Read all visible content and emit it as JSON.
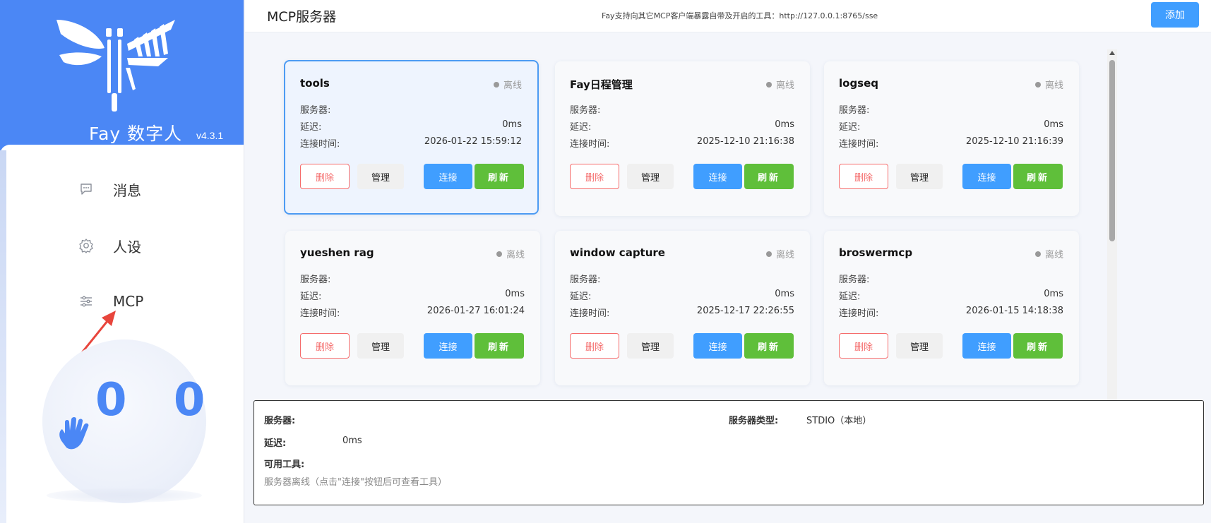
{
  "sidebar": {
    "brand_name": "Fay 数字人",
    "version": "v4.3.1",
    "nav": [
      {
        "label": "消息",
        "icon": "message-icon"
      },
      {
        "label": "人设",
        "icon": "gear-icon"
      },
      {
        "label": "MCP",
        "icon": "sliders-icon"
      }
    ],
    "avatar_eyes": "0 0"
  },
  "header": {
    "title": "MCP服务器",
    "info": "Fay支持向其它MCP客户端暴露自带及开启的工具：http://127.0.0.1:8765/sse",
    "add_label": "添加"
  },
  "card_labels": {
    "server": "服务器:",
    "latency": "延迟:",
    "connect_time": "连接时间:",
    "delete": "删除",
    "manage": "管理",
    "connect": "连接",
    "refresh": "刷新"
  },
  "cards": [
    {
      "name": "tools",
      "status": "离线",
      "server": "",
      "latency": "0ms",
      "time": "2026-01-22 15:59:12",
      "selected": true
    },
    {
      "name": "Fay日程管理",
      "status": "离线",
      "server": "",
      "latency": "0ms",
      "time": "2025-12-10 21:16:38",
      "selected": false
    },
    {
      "name": "logseq",
      "status": "离线",
      "server": "",
      "latency": "0ms",
      "time": "2025-12-10 21:16:39",
      "selected": false
    },
    {
      "name": "yueshen rag",
      "status": "离线",
      "server": "",
      "latency": "0ms",
      "time": "2026-01-27 16:01:24",
      "selected": false
    },
    {
      "name": "window capture",
      "status": "离线",
      "server": "",
      "latency": "0ms",
      "time": "2025-12-17 22:26:55",
      "selected": false
    },
    {
      "name": "broswermcp",
      "status": "离线",
      "server": "",
      "latency": "0ms",
      "time": "2026-01-15 14:18:38",
      "selected": false
    }
  ],
  "detail": {
    "server_label": "服务器:",
    "server_value": "",
    "type_label": "服务器类型:",
    "type_value": "STDIO（本地）",
    "latency_label": "延迟:",
    "latency_value": "0ms",
    "tools_label": "可用工具:",
    "tools_message": "服务器离线（点击\"连接\"按钮后可查看工具）"
  },
  "colors": {
    "brand": "#4b87f5",
    "primary": "#409eff",
    "success": "#5fbf3a",
    "danger": "#f56c6c",
    "selected_border": "#4c9bf3"
  }
}
